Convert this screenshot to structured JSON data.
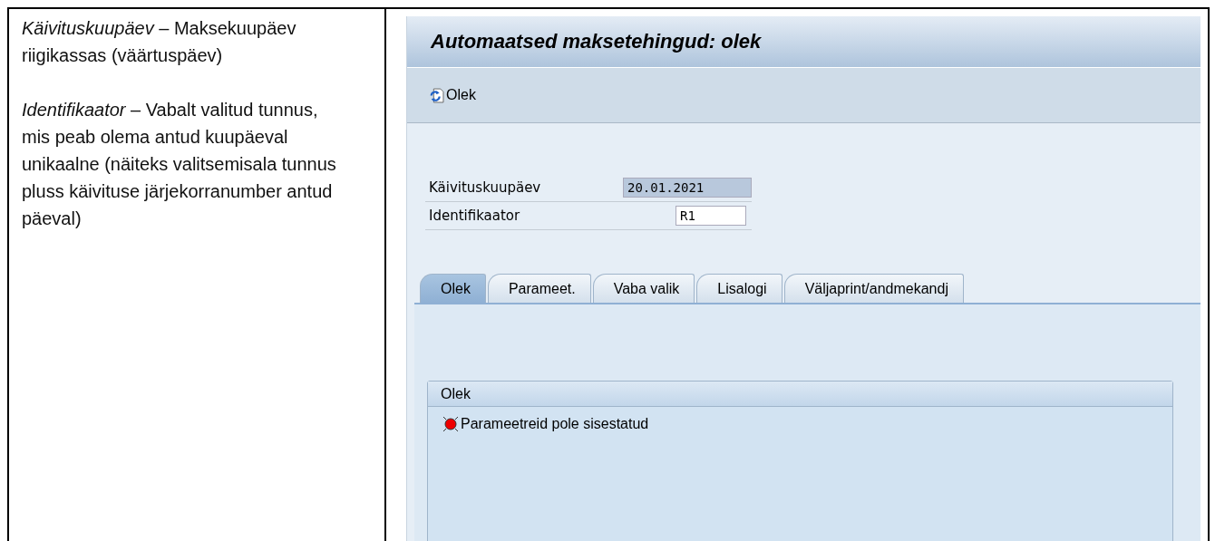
{
  "description": {
    "paragraphs": [
      "*Käivituskuupäev* – Maksekuupäev riigikassas (väärtuspäev)",
      "*Identifikaator* – Vabalt valitud tunnus, mis peab olema antud kuupäeval unikaalne (näiteks valitsemisala tunnus pluss käivituse järjekorranumber antud päeval)"
    ]
  },
  "screen": {
    "title": "Automaatsed maksetehingud: olek",
    "toolbar": [
      {
        "label": "Olek"
      }
    ],
    "fields": [
      {
        "label": "Käivituskuupäev",
        "value": "20.01.2021",
        "selected": true
      },
      {
        "label": "Identifikaator",
        "value": "R1",
        "selected": false
      }
    ],
    "tabs": [
      {
        "label": "Olek",
        "selected": true
      },
      {
        "label": "Parameet.",
        "selected": false
      },
      {
        "label": "Vaba valik",
        "selected": false
      },
      {
        "label": "Lisalogi",
        "selected": false
      },
      {
        "label": "Väljaprint/andmekandj",
        "selected": false
      }
    ],
    "group": {
      "title": "Olek",
      "messages": [
        {
          "color": "#ee0000",
          "text": "Parameetreid pole sisestatud"
        }
      ]
    }
  }
}
